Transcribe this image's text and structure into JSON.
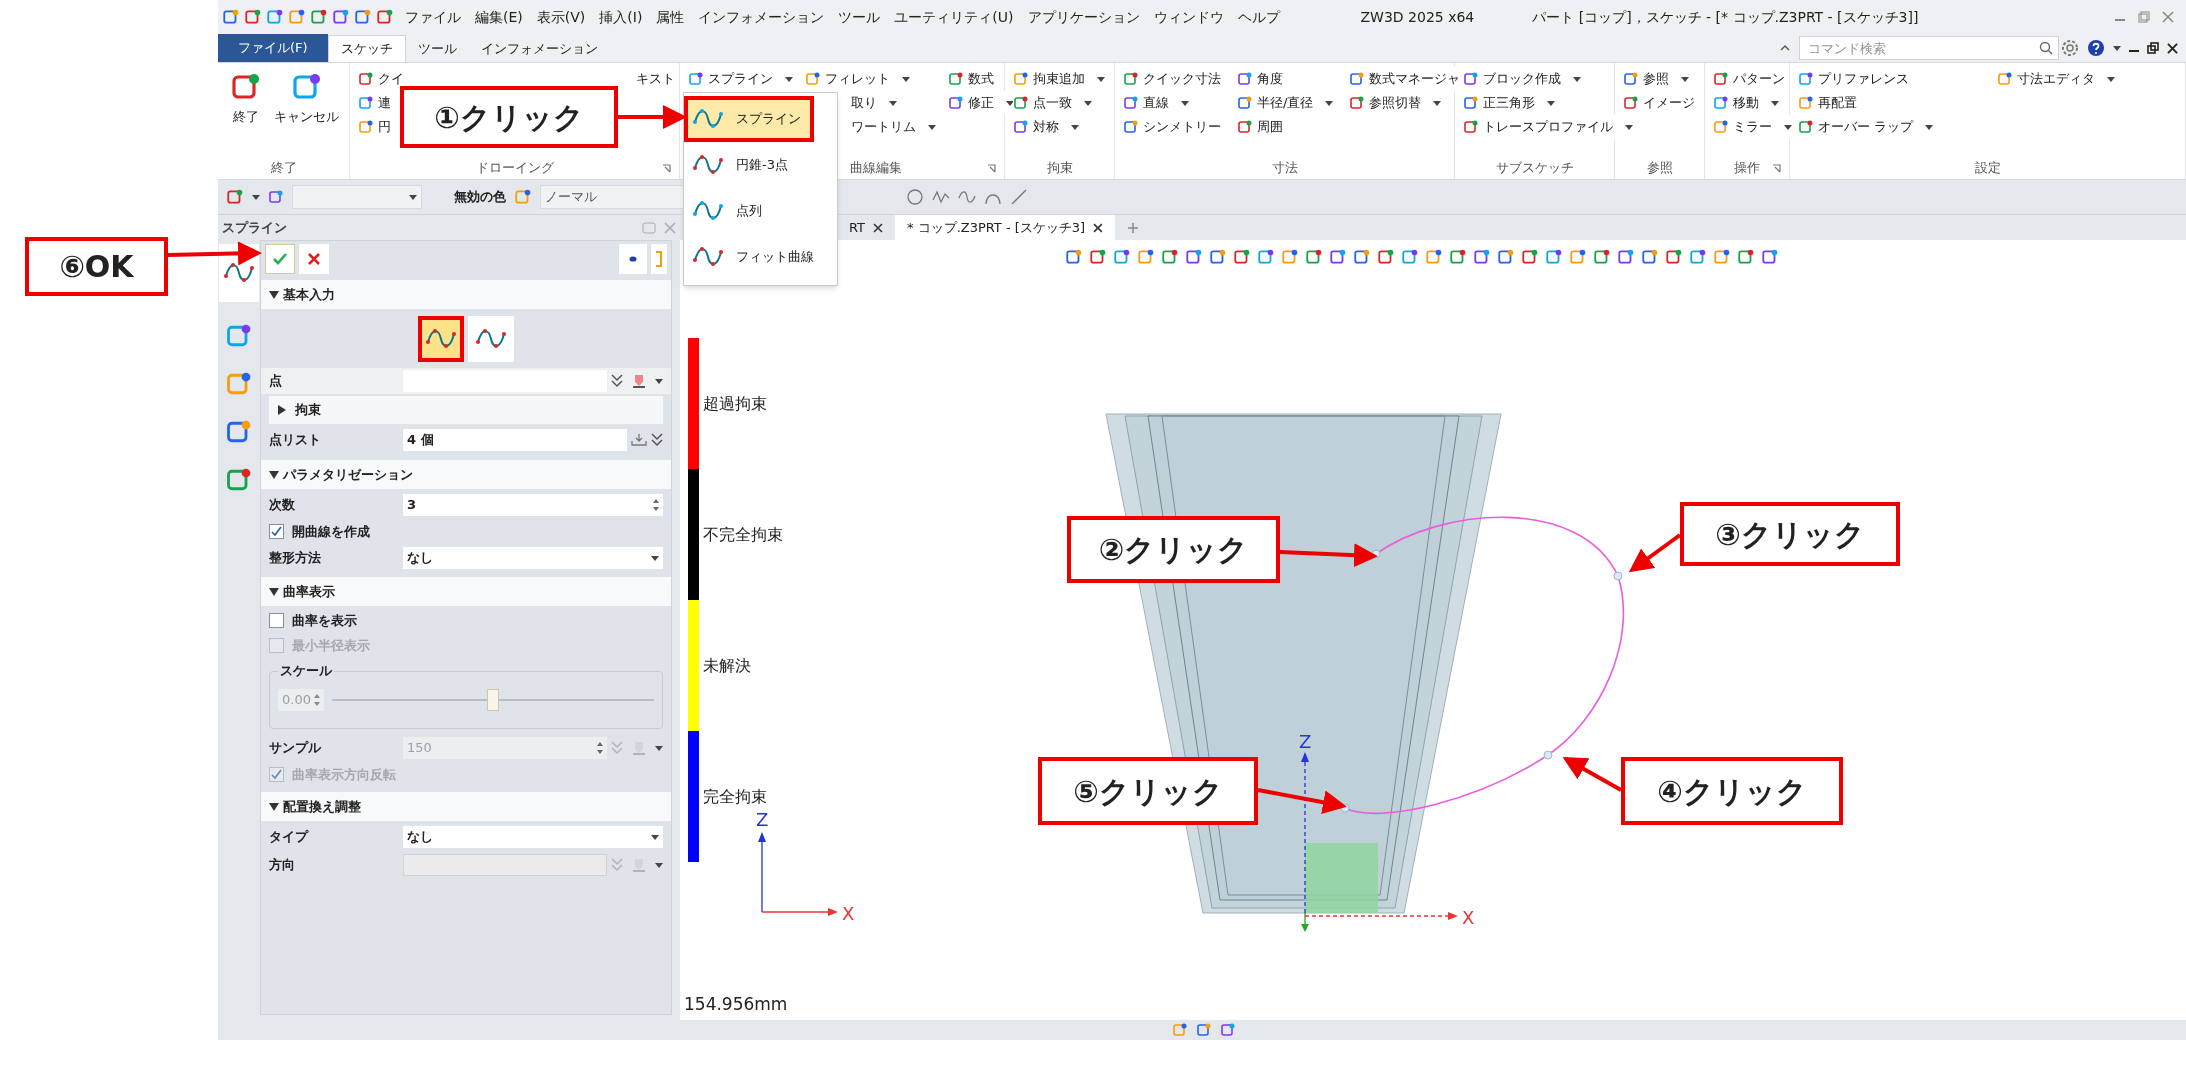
{
  "menu": [
    "ファイル",
    "編集(E)",
    "表示(V)",
    "挿入(I)",
    "属性",
    "インフォメーション",
    "ツール",
    "ユーティリティ(U)",
    "アプリケーション",
    "ウィンドウ",
    "ヘルプ"
  ],
  "title": {
    "app": "ZW3D 2025 x64",
    "document": "パート [コップ]，スケッチ - [* コップ.Z3PRT - [スケッチ3]]"
  },
  "ribbon_tabs": [
    {
      "label": "ファイル(F)",
      "kind": "file",
      "selected": false
    },
    {
      "label": "スケッチ",
      "kind": "tab",
      "selected": true
    },
    {
      "label": "ツール",
      "kind": "tab",
      "selected": false
    },
    {
      "label": "インフォメーション",
      "kind": "tab",
      "selected": false
    }
  ],
  "command_search": {
    "placeholder": "コマンド検索"
  },
  "ribbon_groups": [
    {
      "label": "終了",
      "columns": [
        [
          {
            "kind": "large",
            "label": "終了"
          }
        ],
        [
          {
            "kind": "large",
            "label": "キャンセル"
          }
        ]
      ]
    },
    {
      "label": "ドローイング",
      "launcher": true,
      "columns": [
        [
          {
            "kind": "small",
            "label": "クイ"
          },
          {
            "kind": "small",
            "label": "連"
          },
          {
            "kind": "small",
            "label": "円"
          }
        ],
        [
          {
            "kind": "small",
            "label": "キスト",
            "covered": true
          }
        ]
      ]
    },
    {
      "label": "曲線編集",
      "launcher": true,
      "columns": [
        [
          {
            "kind": "small",
            "label": "スプライン",
            "dropdown": true
          }
        ],
        [
          {
            "kind": "small",
            "label": "フィレット",
            "dropdown": true
          },
          {
            "kind": "small",
            "label": "取り",
            "dropdown": true,
            "covered": true
          },
          {
            "kind": "small",
            "label": "ワートリム",
            "dropdown": true,
            "covered": true
          }
        ],
        [
          {
            "kind": "small",
            "label": "数式"
          },
          {
            "kind": "small",
            "label": "修正",
            "dropdown": true
          }
        ]
      ]
    },
    {
      "label": "拘束",
      "columns": [
        [
          {
            "kind": "small",
            "label": "拘束追加",
            "dropdown": true
          },
          {
            "kind": "small",
            "label": "点一致",
            "dropdown": true
          },
          {
            "kind": "small",
            "label": "対称",
            "dropdown": true
          }
        ]
      ]
    },
    {
      "label": "寸法",
      "columns": [
        [
          {
            "kind": "small",
            "label": "クイック寸法"
          },
          {
            "kind": "small",
            "label": "直線",
            "dropdown": true
          },
          {
            "kind": "small",
            "label": "シンメトリー"
          }
        ],
        [
          {
            "kind": "small",
            "label": "角度"
          },
          {
            "kind": "small",
            "label": "半径/直径",
            "dropdown": true
          },
          {
            "kind": "small",
            "label": "周囲"
          }
        ],
        [
          {
            "kind": "small",
            "label": "数式マネージャ"
          },
          {
            "kind": "small",
            "label": "参照切替",
            "dropdown": true
          }
        ]
      ]
    },
    {
      "label": "サブスケッチ",
      "columns": [
        [
          {
            "kind": "small",
            "label": "ブロック作成",
            "dropdown": true
          },
          {
            "kind": "small",
            "label": "正三角形",
            "dropdown": true
          },
          {
            "kind": "small",
            "label": "トレースプロファイル",
            "dropdown": true
          }
        ]
      ]
    },
    {
      "label": "参照",
      "columns": [
        [
          {
            "kind": "small",
            "label": "参照",
            "dropdown": true
          },
          {
            "kind": "small",
            "label": "イメージ"
          }
        ]
      ]
    },
    {
      "label": "操作",
      "launcher": true,
      "columns": [
        [
          {
            "kind": "small",
            "label": "パターン"
          },
          {
            "kind": "small",
            "label": "移動",
            "dropdown": true
          },
          {
            "kind": "small",
            "label": "ミラー",
            "dropdown": true
          }
        ]
      ]
    },
    {
      "label": "設定",
      "columns": [
        [
          {
            "kind": "small",
            "label": "プリファレンス"
          },
          {
            "kind": "small",
            "label": "再配置"
          },
          {
            "kind": "small",
            "label": "オーバー ラップ",
            "dropdown": true
          }
        ],
        [
          {
            "kind": "small",
            "label": "寸法エディタ",
            "dropdown": true
          }
        ]
      ]
    }
  ],
  "spline_menu": [
    {
      "label": "スプライン",
      "selected": true
    },
    {
      "label": "円錐-3点",
      "selected": false
    },
    {
      "label": "点列",
      "selected": false
    },
    {
      "label": "フィット曲線",
      "selected": false
    }
  ],
  "toolbar": {
    "color_label": "無効の色",
    "mode": "ノーマル"
  },
  "panel": {
    "title": "スプライン",
    "sections": [
      {
        "title": "基本入力",
        "expanded": true,
        "rows": [
          {
            "kind": "type_icons",
            "options": [
              {
                "selected": true
              },
              {
                "selected": false
              }
            ]
          },
          {
            "kind": "field",
            "label": "点",
            "picker": true,
            "disabled": false
          },
          {
            "kind": "group",
            "label": "拘束",
            "expanded": false
          },
          {
            "kind": "list",
            "label": "点リスト",
            "value": "4 個"
          }
        ]
      },
      {
        "title": "パラメタリゼーション",
        "expanded": true,
        "rows": [
          {
            "kind": "spinner",
            "label": "次数",
            "value": "3",
            "disabled": false
          },
          {
            "kind": "checkbox",
            "label": "開曲線を作成",
            "checked": true,
            "disabled": false
          },
          {
            "kind": "select",
            "label": "整形方法",
            "value": "なし"
          }
        ]
      },
      {
        "title": "曲率表示",
        "expanded": true,
        "rows": [
          {
            "kind": "checkbox",
            "label": "曲率を表示",
            "checked": false,
            "disabled": false
          },
          {
            "kind": "checkbox",
            "label": "最小半径表示",
            "checked": false,
            "disabled": true
          },
          {
            "kind": "slider",
            "label": "スケール",
            "value": "0.00",
            "level": 0.5
          },
          {
            "kind": "spinner",
            "label": "サンプル",
            "value": "150",
            "disabled": true,
            "picker": true
          },
          {
            "kind": "checkbox",
            "label": "曲率表示方向反転",
            "checked": true,
            "disabled": true
          }
        ]
      },
      {
        "title": "配置換え調整",
        "expanded": true,
        "rows": [
          {
            "kind": "select",
            "label": "タイプ",
            "value": "なし"
          },
          {
            "kind": "field",
            "label": "方向",
            "picker": true,
            "disabled": true
          }
        ]
      }
    ]
  },
  "doc_tabs": [
    {
      "label": "RT",
      "selected": false
    },
    {
      "label": "* コップ.Z3PRT - [スケッチ3]",
      "selected": true
    }
  ],
  "legend": [
    {
      "label": "超過拘束",
      "color": "#ff0000"
    },
    {
      "label": "不完全拘束",
      "color": "#000000"
    },
    {
      "label": "未解決",
      "color": "#ffff00"
    },
    {
      "label": "完全拘束",
      "color": "#0000ff"
    }
  ],
  "triads": [
    {
      "z": "Z",
      "x": "X"
    },
    {
      "z": "Z",
      "x": "X"
    }
  ],
  "readout": "154.956mm",
  "callouts": [
    "①クリック",
    "②クリック",
    "③クリック",
    "④クリック",
    "⑤クリック",
    "⑥OK"
  ]
}
